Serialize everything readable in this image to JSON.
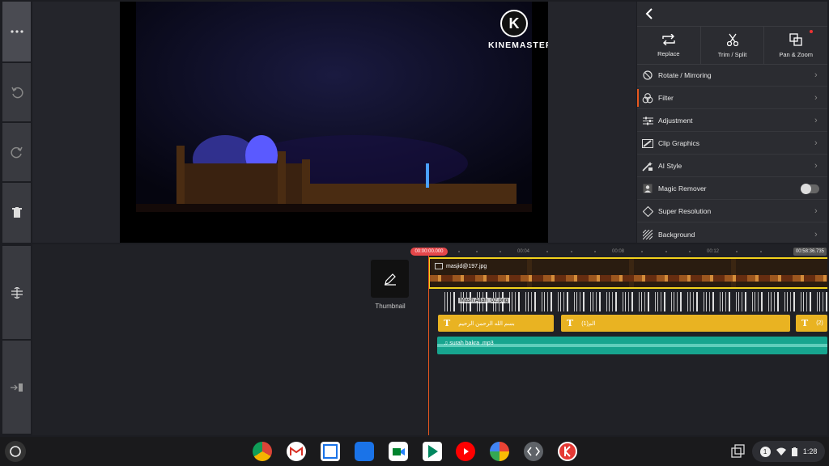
{
  "app": {
    "watermark": "KINEMASTER",
    "watermark_logo": "K"
  },
  "panel": {
    "tools": [
      {
        "label": "Replace",
        "icon": "replace-icon"
      },
      {
        "label": "Trim / Split",
        "icon": "scissors-icon"
      },
      {
        "label": "Pan & Zoom",
        "icon": "pan-zoom-icon"
      }
    ],
    "items": [
      {
        "label": "Rotate / Mirroring"
      },
      {
        "label": "Filter"
      },
      {
        "label": "Adjustment"
      },
      {
        "label": "Clip Graphics"
      },
      {
        "label": "AI Style"
      },
      {
        "label": "Magic Remover"
      },
      {
        "label": "Super Resolution"
      },
      {
        "label": "Background"
      }
    ]
  },
  "timeline": {
    "playhead_time": "00:00:00.000",
    "end_time": "00:58:36.735",
    "ticks": [
      "00:04",
      "00:08",
      "00:12"
    ],
    "thumbnail_label": "Thumbnail",
    "video_clip": "masjid@197.jpg",
    "overlay_clip": "Mash Allah_02.png",
    "text_clips": [
      "بسم الله الرحمن الرحيم",
      "الم(1)",
      "(2)"
    ],
    "audio_clip": "surah bakra .mp3"
  },
  "tray": {
    "notifications": "1",
    "time": "1:28"
  },
  "colors": {
    "accent": "#e8571e",
    "selection": "#f3d21b",
    "text_clip": "#e9b322",
    "audio_clip": "#17a58f"
  }
}
